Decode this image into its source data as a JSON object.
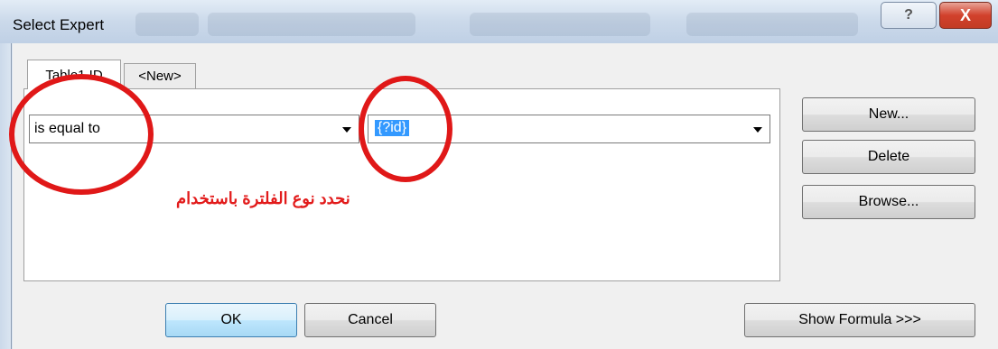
{
  "window": {
    "title": "Select Expert",
    "help_glyph": "?",
    "close_glyph": "X"
  },
  "tabs": [
    {
      "label": "Table1.ID",
      "active": true
    },
    {
      "label": "<New>",
      "active": false
    }
  ],
  "filter": {
    "operator": "is equal to",
    "value": "{?id}"
  },
  "annotation": {
    "text": "نحدد نوع الفلترة باستخدام",
    "color": "#e21b1b"
  },
  "side_buttons": {
    "new": "New...",
    "delete": "Delete",
    "browse": "Browse..."
  },
  "bottom_buttons": {
    "ok": "OK",
    "cancel": "Cancel",
    "show_formula": "Show Formula >>>"
  },
  "colors": {
    "highlight": "#e01818",
    "selection": "#3399ff"
  }
}
